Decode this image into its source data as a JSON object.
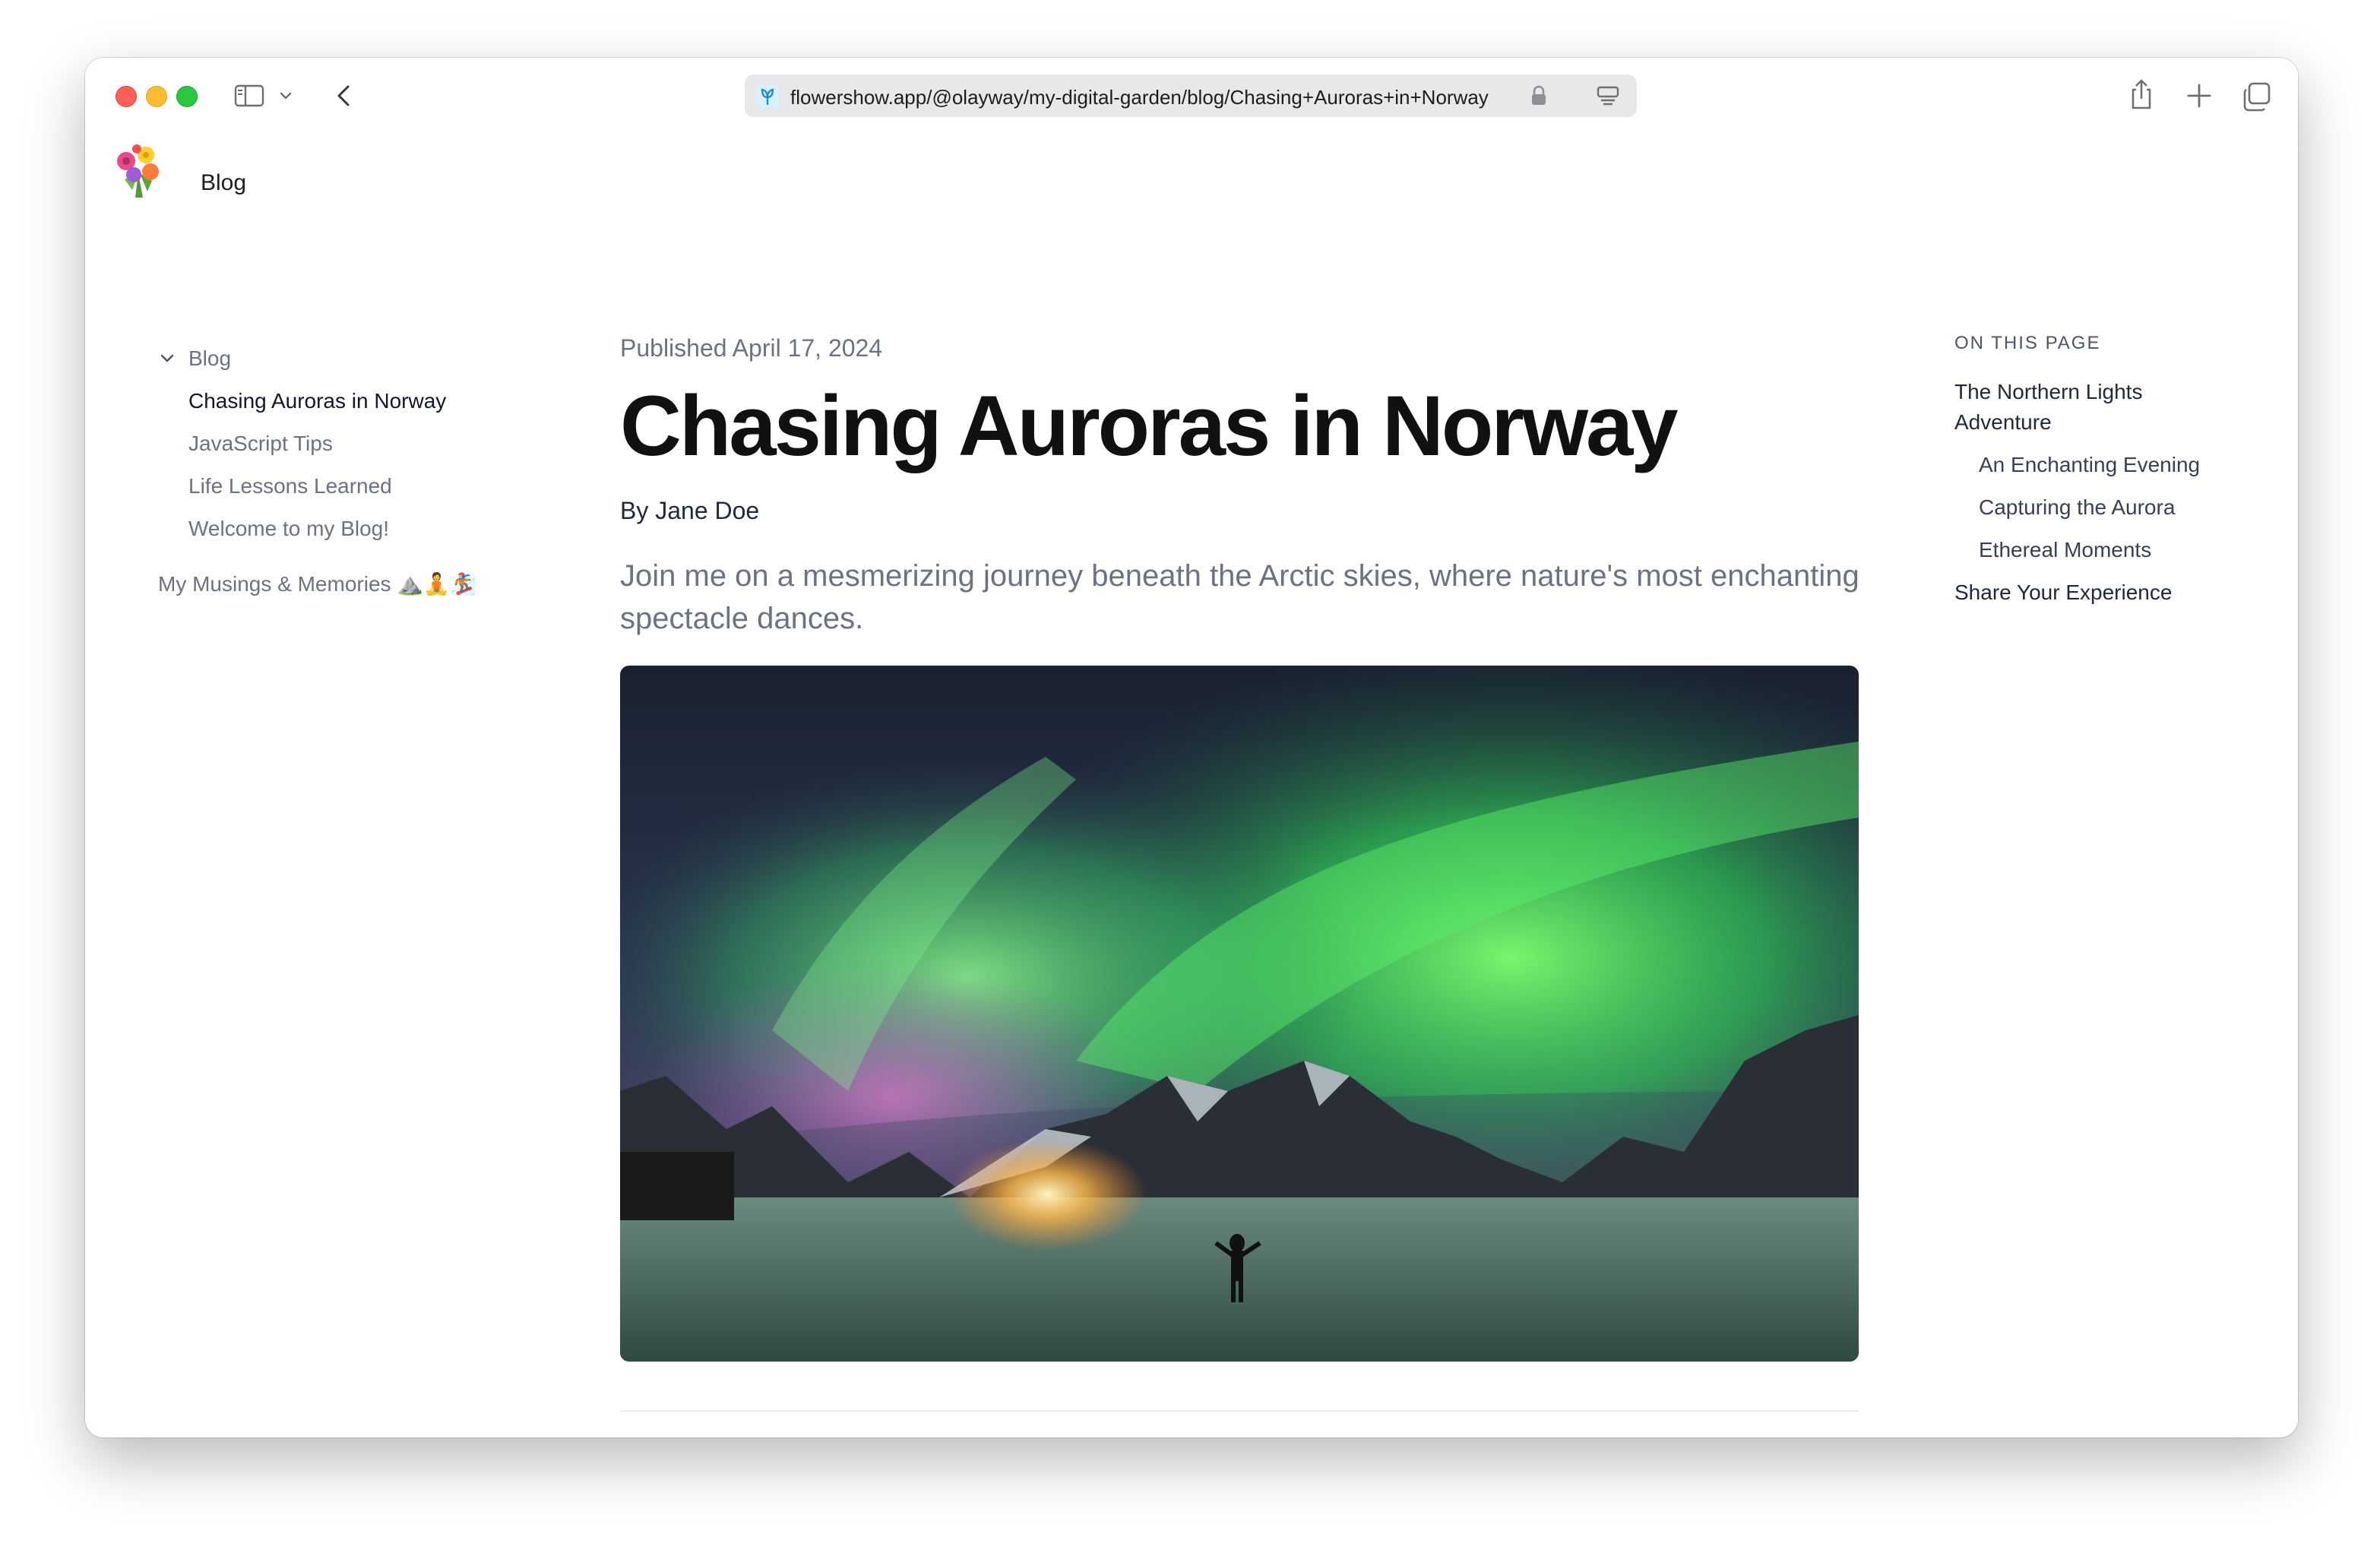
{
  "browser": {
    "url": "flowershow.app/@olayway/my-digital-garden/blog/Chasing+Auroras+in+Norway",
    "icons": [
      "sidebar-toggle-icon",
      "chevron-down-icon",
      "back-icon",
      "lock-icon",
      "reader-icon",
      "share-icon",
      "new-tab-icon",
      "tabs-overview-icon"
    ]
  },
  "site": {
    "header_title": "Blog"
  },
  "sidebar": {
    "section_label": "Blog",
    "items": [
      {
        "label": "Chasing Auroras in Norway",
        "active": true
      },
      {
        "label": "JavaScript Tips",
        "active": false
      },
      {
        "label": "Life Lessons Learned",
        "active": false
      },
      {
        "label": "Welcome to my Blog!",
        "active": false
      }
    ],
    "other_section": "My Musings & Memories ⛰️🧘🏂"
  },
  "article": {
    "published": "Published April 17, 2024",
    "title": "Chasing Auroras in Norway",
    "author": "By Jane Doe",
    "description": "Join me on a mesmerizing journey beneath the Arctic skies, where nature's most enchanting spectacle dances."
  },
  "toc": {
    "heading": "ON THIS PAGE",
    "items": [
      {
        "label": "The Northern Lights Adventure",
        "level": 1
      },
      {
        "label": "An Enchanting Evening",
        "level": 2
      },
      {
        "label": "Capturing the Aurora",
        "level": 2
      },
      {
        "label": "Ethereal Moments",
        "level": 2
      },
      {
        "label": "Share Your Experience",
        "level": 1
      }
    ]
  },
  "colors": {
    "close": "#ff5f57",
    "minimize": "#febc2e",
    "maximize": "#28c840",
    "aurora": "#3ee06a"
  }
}
